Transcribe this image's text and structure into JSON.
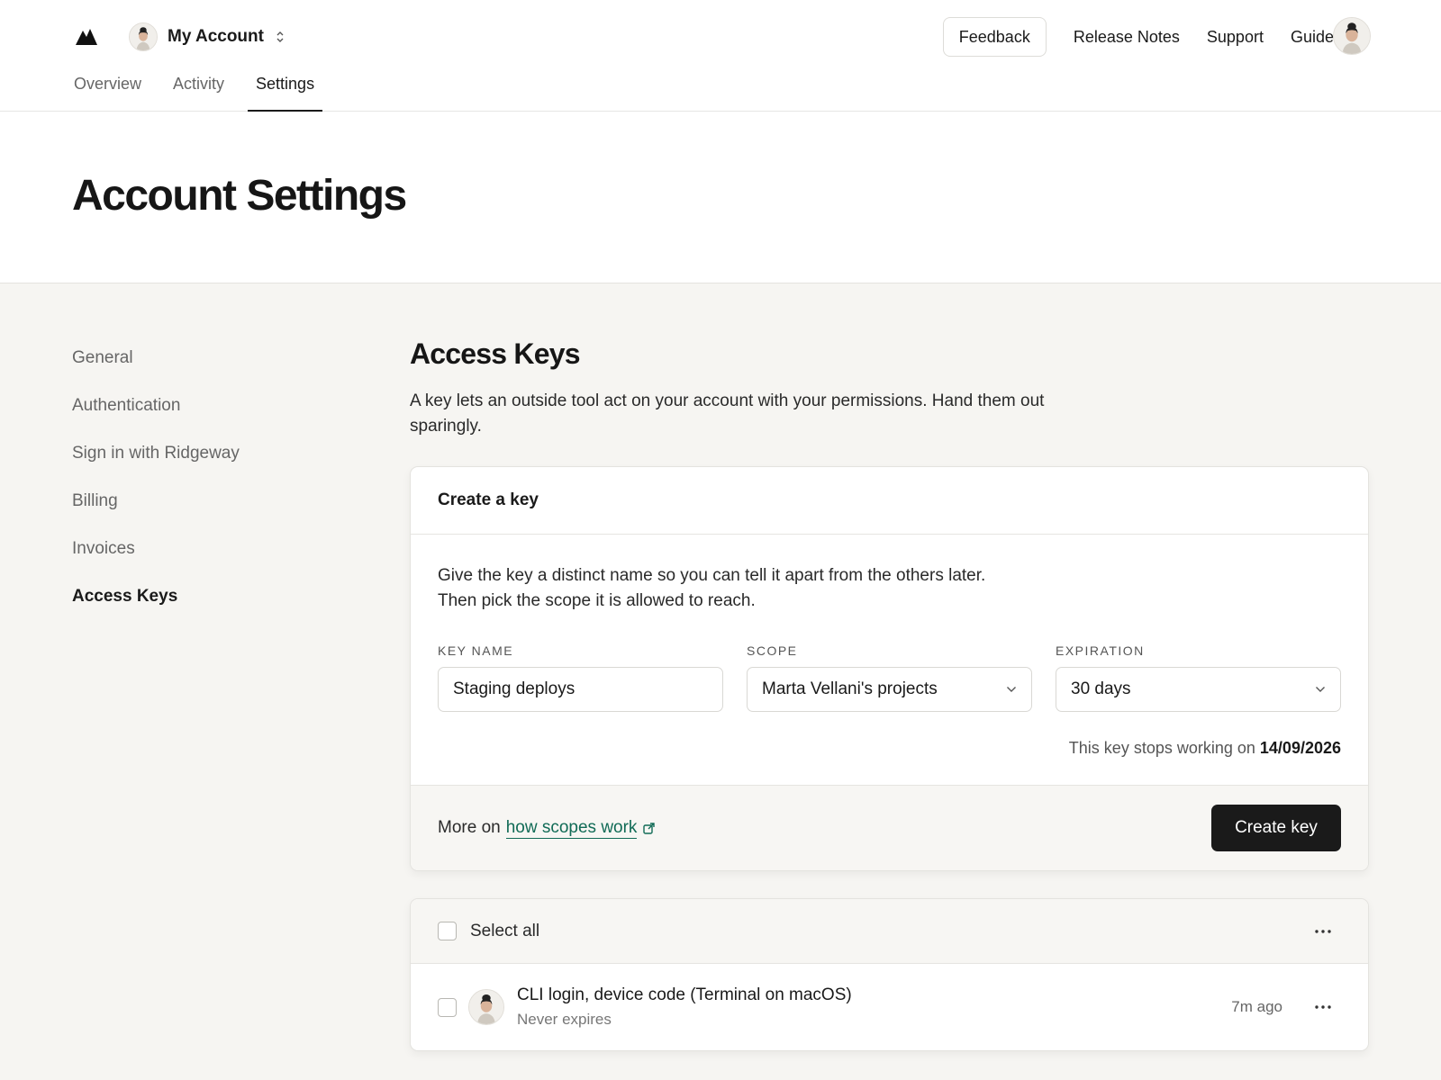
{
  "header": {
    "account_name": "My Account",
    "feedback_label": "Feedback",
    "links": [
      "Release Notes",
      "Support",
      "Guides"
    ]
  },
  "tabs": [
    {
      "label": "Overview",
      "active": false
    },
    {
      "label": "Activity",
      "active": false
    },
    {
      "label": "Settings",
      "active": true
    }
  ],
  "page_title": "Account Settings",
  "sidebar": {
    "items": [
      {
        "label": "General",
        "active": false
      },
      {
        "label": "Authentication",
        "active": false
      },
      {
        "label": "Sign in with Ridgeway",
        "active": false
      },
      {
        "label": "Billing",
        "active": false
      },
      {
        "label": "Invoices",
        "active": false
      },
      {
        "label": "Access Keys",
        "active": true
      }
    ]
  },
  "section": {
    "title": "Access Keys",
    "description": "A key lets an outside tool act on your account with your permissions. Hand them out sparingly."
  },
  "create_card": {
    "title": "Create a key",
    "intro_line1": "Give the key a distinct name so you can tell it apart from the others later.",
    "intro_line2": "Then pick the scope it is allowed to reach.",
    "key_name_label": "KEY NAME",
    "key_name_value": "Staging deploys",
    "scope_label": "SCOPE",
    "scope_value": "Marta Vellani's projects",
    "expiration_label": "EXPIRATION",
    "expiration_value": "30 days",
    "expiry_prefix": "This key stops working on",
    "expiry_date": "14/09/2026",
    "more_prefix": "More on",
    "more_link": "how scopes work",
    "create_button": "Create key"
  },
  "keys_list": {
    "select_all_label": "Select all",
    "rows": [
      {
        "title": "CLI login, device code (Terminal on macOS)",
        "subtitle": "Never expires",
        "time": "7m ago"
      }
    ]
  },
  "colors": {
    "accent_link": "#116b56",
    "primary_button": "#1a1a1a",
    "content_background": "#f6f5f2"
  },
  "icons": [
    "logo-mountain-icon",
    "avatar",
    "chevron-updown-icon",
    "chevron-down-icon",
    "external-link-icon",
    "more-dots-icon"
  ]
}
